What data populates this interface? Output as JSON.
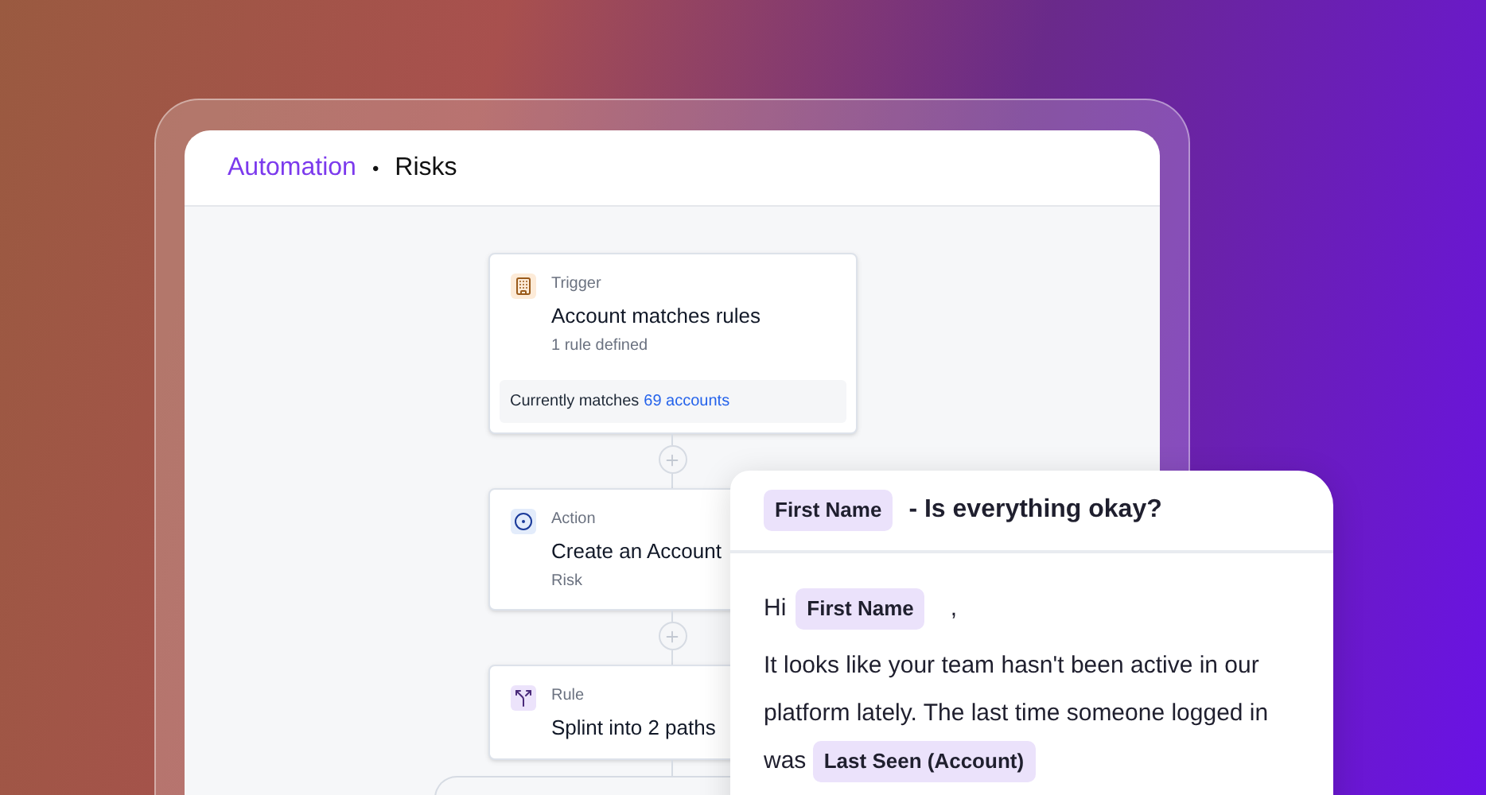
{
  "header": {
    "section": "Automation",
    "separator": "•",
    "page": "Risks"
  },
  "flow": {
    "steps": [
      {
        "kind": "trigger",
        "type_label": "Trigger",
        "title": "Account matches rules",
        "subtitle": "1 rule defined",
        "footer": {
          "text": "Currently matches",
          "link": "69 accounts"
        }
      },
      {
        "kind": "action",
        "type_label": "Action",
        "title": "Create an Account",
        "subtitle": "Risk"
      },
      {
        "kind": "rule",
        "type_label": "Rule",
        "title": "Splint into 2 paths"
      }
    ]
  },
  "email": {
    "subject": {
      "token": "First Name",
      "text": "- Is everything okay?"
    },
    "greeting": {
      "text": "Hi",
      "token": "First Name",
      "punctuation": ","
    },
    "body": {
      "text": "It looks like your team hasn't been active in our platform lately. The last time someone logged in was",
      "token": "Last Seen (Account)"
    }
  }
}
